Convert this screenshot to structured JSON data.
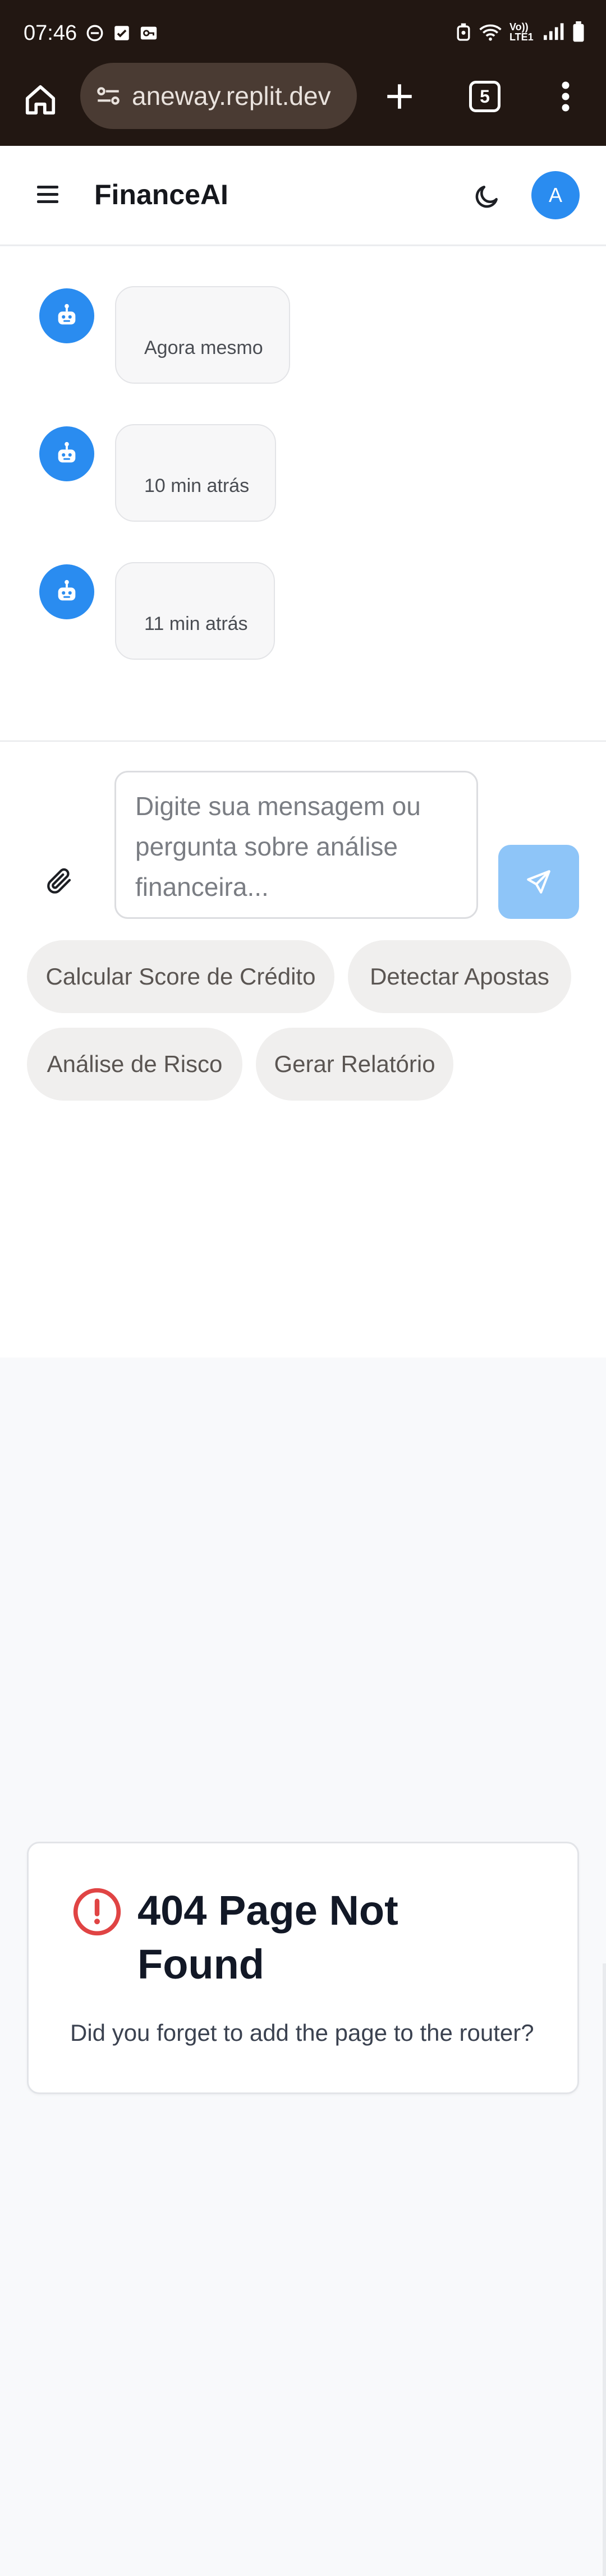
{
  "status_bar": {
    "time": "07:46",
    "icons": [
      "do-not-disturb-icon",
      "checkbox-icon",
      "key-icon",
      "alarm-icon",
      "wifi-icon",
      "volte-icon",
      "signal-icon",
      "battery-icon"
    ],
    "network_label": "Vo)) LTE1"
  },
  "browser": {
    "url": "aneway.replit.dev",
    "tab_count": "5"
  },
  "header": {
    "title": "FinanceAI",
    "avatar_initial": "A"
  },
  "chat": {
    "messages": [
      {
        "time": "Agora mesmo"
      },
      {
        "time": "10 min atrás"
      },
      {
        "time": "11 min atrás"
      }
    ]
  },
  "composer": {
    "placeholder": "Digite sua mensagem ou pergunta sobre análise financeira..."
  },
  "quick_actions": [
    {
      "label": "Calcular Score de Crédito"
    },
    {
      "label": "Detectar Apostas"
    },
    {
      "label": "Análise de Risco"
    },
    {
      "label": "Gerar Relatório"
    }
  ],
  "not_found": {
    "title": "404 Page Not Found",
    "message": "Did you forget to add the page to the router?"
  },
  "colors": {
    "brand_blue": "#2a8cf0",
    "send_disabled": "#8ec5f8",
    "error_red": "#e04444",
    "browser_bar": "#221712"
  }
}
